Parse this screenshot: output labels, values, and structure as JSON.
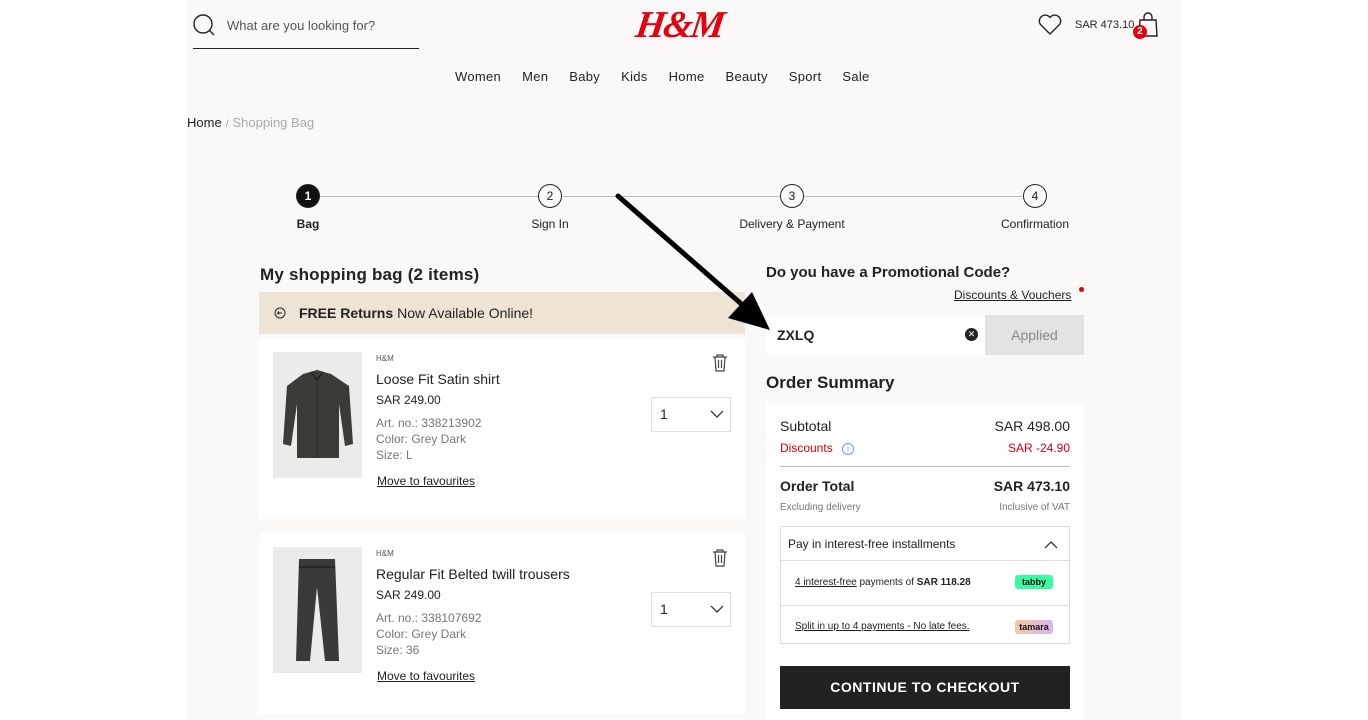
{
  "header": {
    "search_placeholder": "What are you looking for?",
    "logo": "H&M",
    "cart_total": "SAR 473.10",
    "bag_count": "2"
  },
  "nav": [
    "Women",
    "Men",
    "Baby",
    "Kids",
    "Home",
    "Beauty",
    "Sport",
    "Sale"
  ],
  "breadcrumb": {
    "home": "Home",
    "separator": "/",
    "current": "Shopping Bag"
  },
  "steps": [
    {
      "number": "1",
      "label": "Bag"
    },
    {
      "number": "2",
      "label": "Sign In"
    },
    {
      "number": "3",
      "label": "Delivery & Payment"
    },
    {
      "number": "4",
      "label": "Confirmation"
    }
  ],
  "bag": {
    "title": "My shopping bag (2 items)",
    "banner_bold": "FREE Returns",
    "banner_text": "Now Available Online!",
    "items": [
      {
        "brand": "H&M",
        "name": "Loose Fit Satin shirt",
        "price": "SAR 249.00",
        "art_no": "Art. no.: 338213902",
        "color": "Color: Grey Dark",
        "size": "Size: L",
        "quantity": "1",
        "favourite_link": "Move to favourites"
      },
      {
        "brand": "H&M",
        "name": "Regular Fit Belted twill trousers",
        "price": "SAR 249.00",
        "art_no": "Art. no.: 338107692",
        "color": "Color: Grey Dark",
        "size": "Size: 36",
        "quantity": "1",
        "favourite_link": "Move to favourites"
      }
    ]
  },
  "promo": {
    "title": "Do you have a Promotional Code?",
    "link": "Discounts & Vouchers",
    "code": "ZXLQ",
    "button": "Applied"
  },
  "summary": {
    "title": "Order Summary",
    "subtotal_label": "Subtotal",
    "subtotal_value": "SAR 498.00",
    "discounts_label": "Discounts",
    "discounts_value": "SAR -24.90",
    "total_label": "Order Total",
    "total_value": "SAR 473.10",
    "excluding": "Excluding delivery",
    "inclusive": "Inclusive of VAT",
    "installments_title": "Pay in interest-free installments",
    "tabby_link": "4 interest-free",
    "tabby_text": " payments of ",
    "tabby_amount": "SAR 118.28",
    "tabby_badge": "tabby",
    "tamara_text": "Split in up to 4 payments - No late fees.",
    "tamara_badge": "tamara",
    "checkout": "CONTINUE TO CHECKOUT"
  },
  "colors": {
    "brand_red": "#e50010",
    "dark": "#222222",
    "banner": "#eee3d4",
    "tabby": "#3bfba0"
  }
}
